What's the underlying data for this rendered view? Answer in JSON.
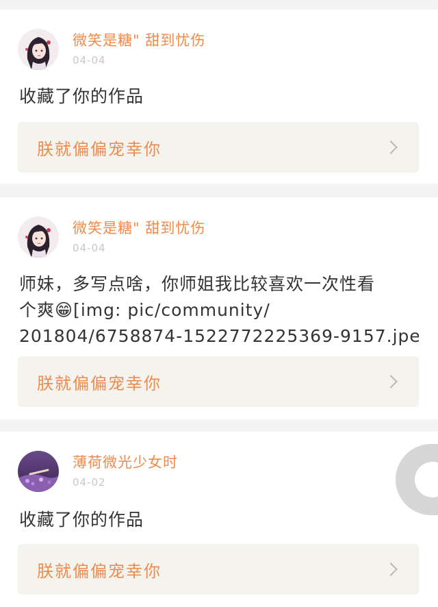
{
  "feed": {
    "items": [
      {
        "username": "微笑是糖\" 甜到忧伤",
        "date": "04-04",
        "content_lines": [
          "收藏了你的作品"
        ],
        "avatar_icon": "anime-girl-avatar-icon",
        "work_title": "朕就偏偏宠幸你"
      },
      {
        "username": "微笑是糖\" 甜到忧伤",
        "date": "04-04",
        "content_lines": [
          "师妹，多写点啥，你师姐我比较喜欢一次性看",
          "个爽😁[img: pic/community/",
          "201804/6758874-1522772225369-9157.jpe…"
        ],
        "avatar_icon": "anime-girl-avatar-icon",
        "work_title": "朕就偏偏宠幸你"
      },
      {
        "username": "薄荷微光少女时",
        "date": "04-02",
        "content_lines": [
          "收藏了你的作品"
        ],
        "avatar_icon": "purple-flowers-avatar-icon",
        "work_title": "朕就偏偏宠幸你"
      }
    ]
  },
  "colors": {
    "accent": "#f08a4b",
    "text": "#333333",
    "date": "#c8c8c8",
    "link_bg": "#f5f3ee",
    "page_bg": "#f4f4f4"
  },
  "floating_button_icon": "ring-icon"
}
